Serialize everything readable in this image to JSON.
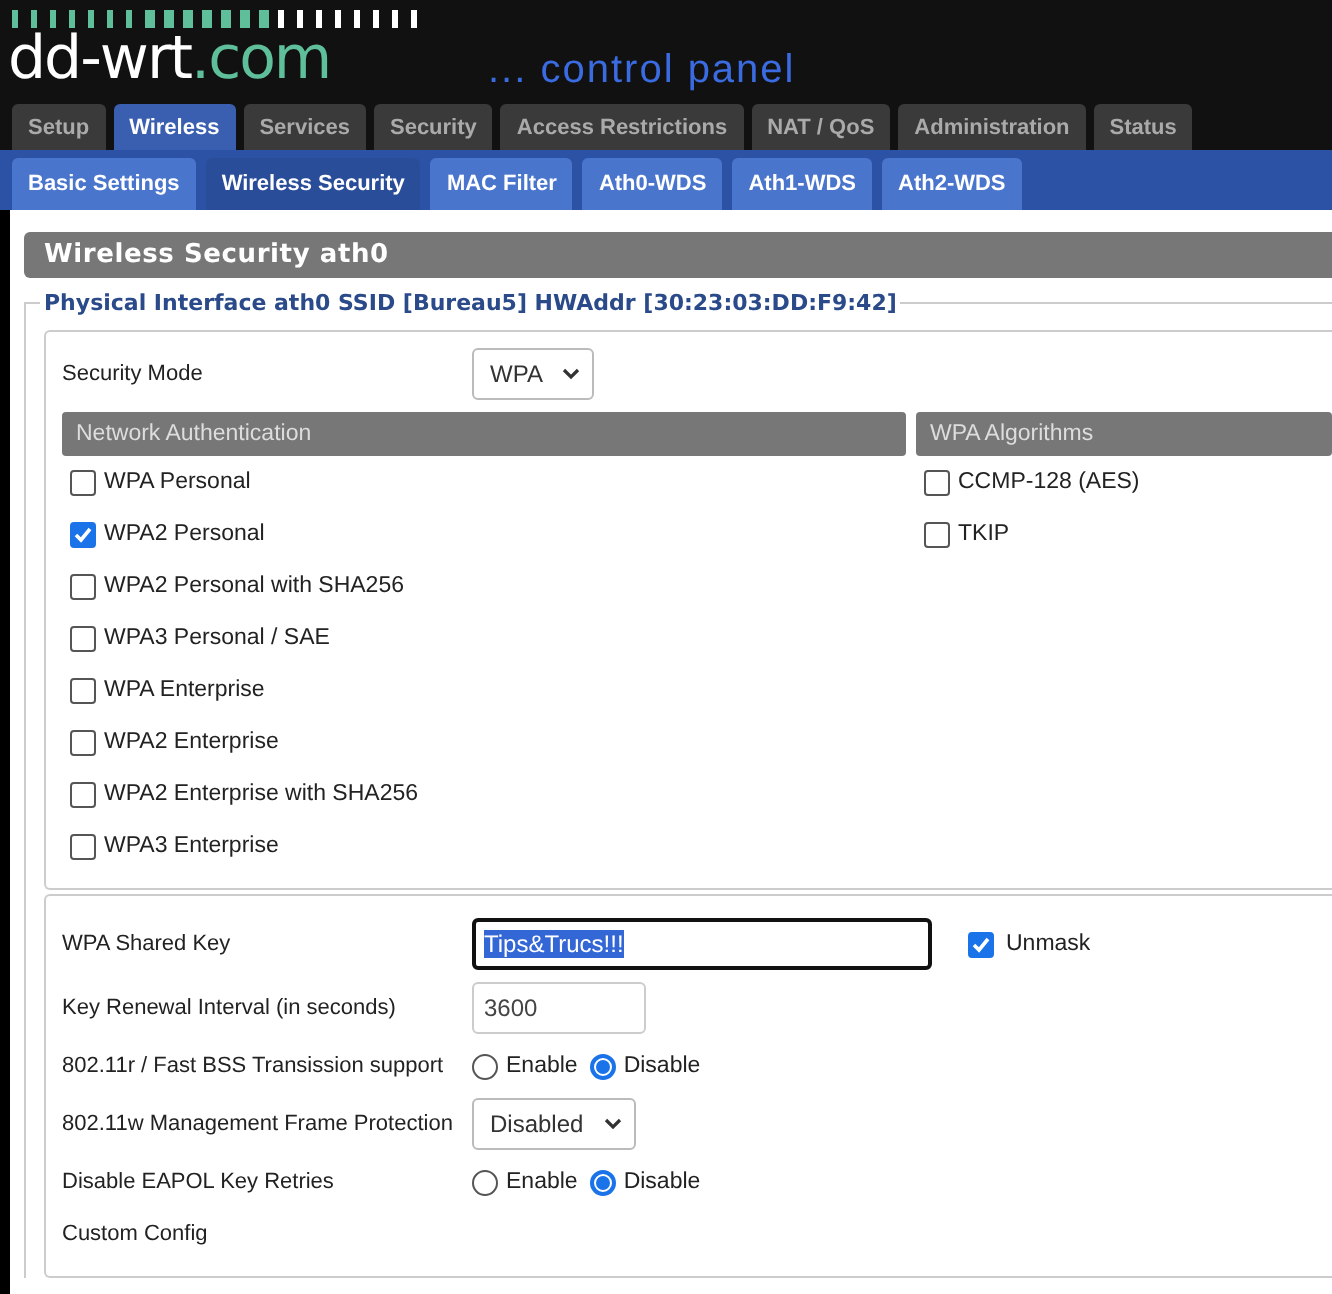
{
  "header": {
    "logo_name": "dd-wrt",
    "logo_domain": ".com",
    "tagline": "... control panel"
  },
  "main_tabs": [
    {
      "label": "Setup",
      "selected": false
    },
    {
      "label": "Wireless",
      "selected": true
    },
    {
      "label": "Services",
      "selected": false
    },
    {
      "label": "Security",
      "selected": false
    },
    {
      "label": "Access Restrictions",
      "selected": false
    },
    {
      "label": "NAT / QoS",
      "selected": false
    },
    {
      "label": "Administration",
      "selected": false
    },
    {
      "label": "Status",
      "selected": false
    }
  ],
  "sub_tabs": [
    {
      "label": "Basic Settings",
      "selected": false
    },
    {
      "label": "Wireless Security",
      "selected": true
    },
    {
      "label": "MAC Filter",
      "selected": false
    },
    {
      "label": "Ath0-WDS",
      "selected": false
    },
    {
      "label": "Ath1-WDS",
      "selected": false
    },
    {
      "label": "Ath2-WDS",
      "selected": false
    }
  ],
  "section_title": "Wireless Security ath0",
  "interface_legend": "Physical Interface ath0 SSID [Bureau5] HWAddr [30:23:03:DD:F9:42]",
  "security_mode": {
    "label": "Security Mode",
    "value": "WPA"
  },
  "auth": {
    "heading": "Network Authentication",
    "options": [
      {
        "label": "WPA Personal",
        "checked": false
      },
      {
        "label": "WPA2 Personal",
        "checked": true
      },
      {
        "label": "WPA2 Personal with SHA256",
        "checked": false
      },
      {
        "label": "WPA3 Personal / SAE",
        "checked": false
      },
      {
        "label": "WPA Enterprise",
        "checked": false
      },
      {
        "label": "WPA2 Enterprise",
        "checked": false
      },
      {
        "label": "WPA2 Enterprise with SHA256",
        "checked": false
      },
      {
        "label": "WPA3 Enterprise",
        "checked": false
      }
    ]
  },
  "algorithms": {
    "heading": "WPA Algorithms",
    "options": [
      {
        "label": "CCMP-128 (AES)",
        "checked": false
      },
      {
        "label": "TKIP",
        "checked": false
      }
    ]
  },
  "settings": [
    {
      "kind": "key",
      "label": "WPA Shared Key",
      "value": "Tips&Trucs!!!",
      "text_selected": true,
      "unmask": {
        "label": "Unmask",
        "checked": true
      }
    },
    {
      "kind": "text",
      "label": "Key Renewal Interval (in seconds)",
      "value": "3600"
    },
    {
      "kind": "radio",
      "label": "802.11r / Fast BSS Transission support",
      "options": [
        {
          "label": "Enable",
          "selected": false
        },
        {
          "label": "Disable",
          "selected": true
        }
      ]
    },
    {
      "kind": "select",
      "label": "802.11w Management Frame Protection",
      "value": "Disabled"
    },
    {
      "kind": "radio",
      "label": "Disable EAPOL Key Retries",
      "options": [
        {
          "label": "Enable",
          "selected": false
        },
        {
          "label": "Disable",
          "selected": true
        }
      ]
    },
    {
      "kind": "plain",
      "label": "Custom Config"
    }
  ]
}
